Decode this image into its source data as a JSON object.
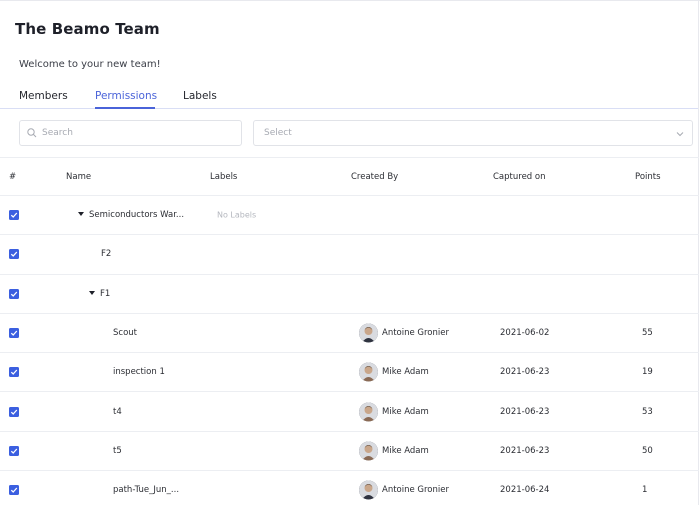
{
  "team": {
    "title": "The Beamo Team",
    "welcome": "Welcome to your new team!"
  },
  "tabs": [
    {
      "label": "Members",
      "active": false
    },
    {
      "label": "Permissions",
      "active": true
    },
    {
      "label": "Labels",
      "active": false
    }
  ],
  "filters": {
    "search_placeholder": "Search",
    "select_placeholder": "Select"
  },
  "colors": {
    "accent": "#4a63d9",
    "checkbox": "#3b5fe0"
  },
  "table": {
    "headers": [
      "#",
      "Name",
      "Labels",
      "Created By",
      "Captured on",
      "Points"
    ],
    "rows": [
      {
        "name": "Semiconductors War...",
        "labels": "No Labels",
        "created_by": "",
        "captured_on": "",
        "points": "",
        "expandable": true
      },
      {
        "name": "F2",
        "labels": "",
        "created_by": "",
        "captured_on": "",
        "points": "",
        "expandable": false
      },
      {
        "name": "F1",
        "labels": "",
        "created_by": "",
        "captured_on": "",
        "points": "",
        "expandable": true
      },
      {
        "name": "Scout",
        "labels": "",
        "created_by": "Antoine Gronier",
        "captured_on": "2021-06-02",
        "points": "55",
        "expandable": false
      },
      {
        "name": "inspection 1",
        "labels": "",
        "created_by": "Mike Adam",
        "captured_on": "2021-06-23",
        "points": "19",
        "expandable": false
      },
      {
        "name": "t4",
        "labels": "",
        "created_by": "Mike Adam",
        "captured_on": "2021-06-23",
        "points": "53",
        "expandable": false
      },
      {
        "name": "t5",
        "labels": "",
        "created_by": "Mike Adam",
        "captured_on": "2021-06-23",
        "points": "50",
        "expandable": false
      },
      {
        "name": "path-Tue_Jun_...",
        "labels": "",
        "created_by": "Antoine Gronier",
        "captured_on": "2021-06-24",
        "points": "1",
        "expandable": false
      }
    ]
  }
}
